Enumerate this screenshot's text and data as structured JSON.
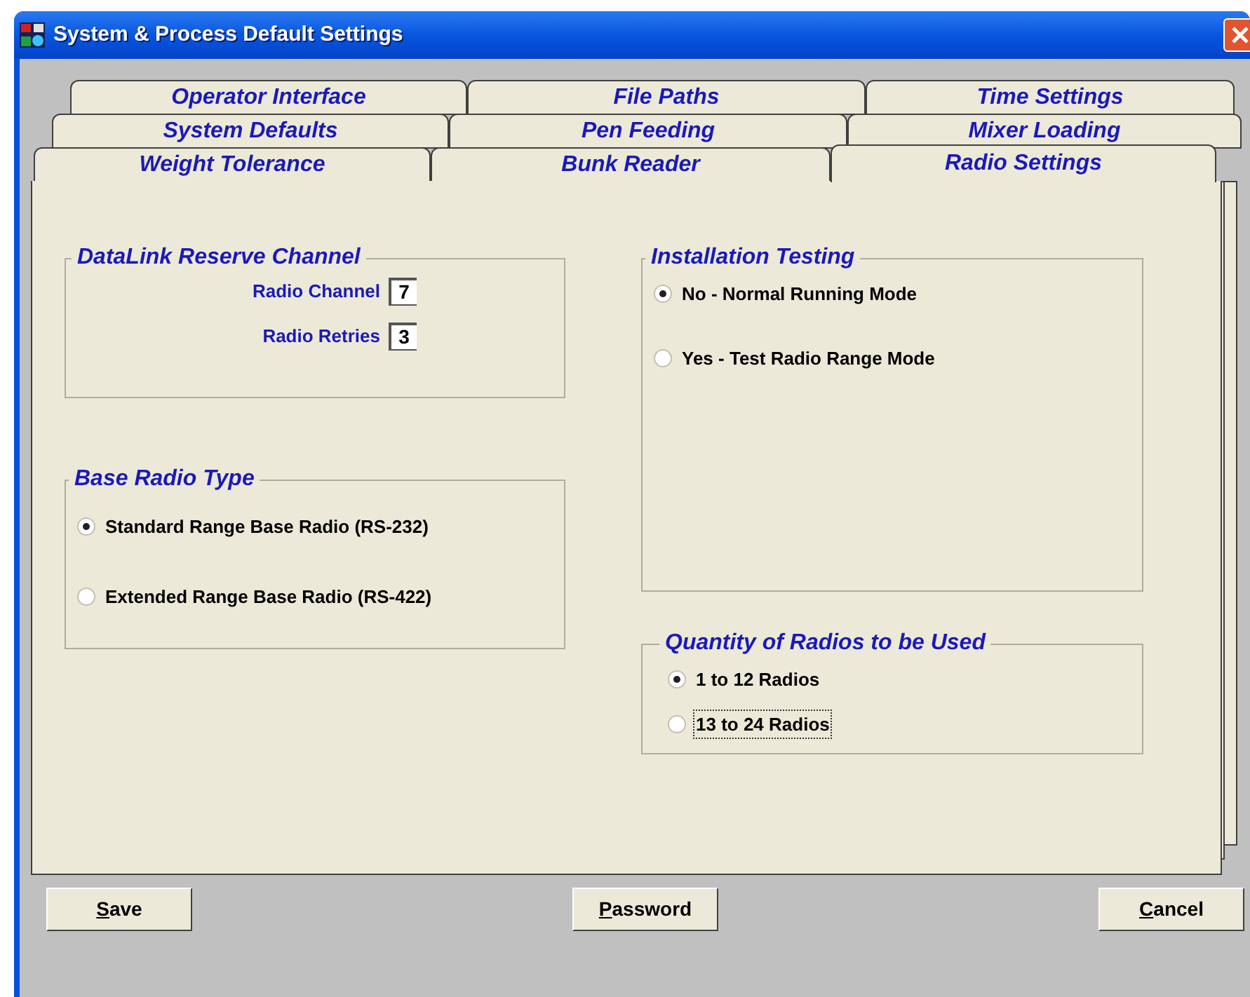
{
  "window": {
    "title": "System & Process Default Settings"
  },
  "tab_rows": [
    {
      "tabs": [
        {
          "label": "Operator Interface",
          "selected": false
        },
        {
          "label": "File Paths",
          "selected": false
        },
        {
          "label": "Time Settings",
          "selected": false
        }
      ]
    },
    {
      "tabs": [
        {
          "label": "System Defaults",
          "selected": false
        },
        {
          "label": "Pen Feeding",
          "selected": false
        },
        {
          "label": "Mixer Loading",
          "selected": false
        }
      ]
    },
    {
      "tabs": [
        {
          "label": "Weight Tolerance",
          "selected": false
        },
        {
          "label": "Bunk Reader",
          "selected": false
        },
        {
          "label": "Radio Settings",
          "selected": true
        }
      ]
    }
  ],
  "datalink_group": {
    "title": "DataLink Reserve Channel",
    "fields": [
      {
        "label": "Radio Channel",
        "value": "7"
      },
      {
        "label": "Radio Retries",
        "value": "3"
      }
    ]
  },
  "base_radio_group": {
    "title": "Base Radio Type",
    "options": [
      {
        "label": "Standard Range Base Radio (RS-232)",
        "selected": true
      },
      {
        "label": "Extended Range Base Radio (RS-422)",
        "selected": false
      }
    ]
  },
  "installation_group": {
    "title": "Installation Testing",
    "options": [
      {
        "label": "No - Normal Running Mode",
        "selected": true
      },
      {
        "label": "Yes - Test Radio Range Mode",
        "selected": false
      }
    ]
  },
  "quantity_group": {
    "title": "Quantity of Radios to be Used",
    "options": [
      {
        "label": "1 to 12 Radios",
        "selected": true,
        "focused": false
      },
      {
        "label": "13 to 24 Radios",
        "selected": false,
        "focused": true
      }
    ]
  },
  "buttons": [
    {
      "access_key": "S",
      "rest": "ave"
    },
    {
      "access_key": "P",
      "rest": "assword"
    },
    {
      "access_key": "C",
      "rest": "ancel"
    }
  ]
}
